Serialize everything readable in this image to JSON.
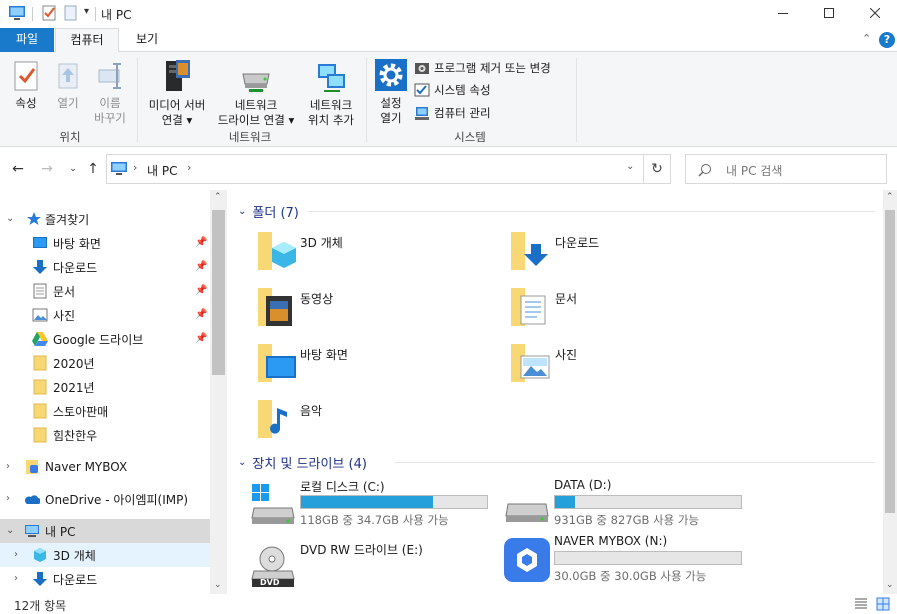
{
  "window": {
    "title": "내 PC"
  },
  "ribbon_tabs": {
    "file": "파일",
    "computer": "컴퓨터",
    "view": "보기"
  },
  "ribbon": {
    "properties": "속성",
    "open": "열기",
    "rename_l1": "이름",
    "rename_l2": "바꾸기",
    "group_location": "위치",
    "media_server_l1": "미디어 서버",
    "media_server_l2": "연결",
    "map_drive_l1": "네트워크",
    "map_drive_l2": "드라이브 연결",
    "add_location_l1": "네트워크",
    "add_location_l2": "위치 추가",
    "group_network": "네트워크",
    "settings_l1": "설정",
    "settings_l2": "열기",
    "uninstall": "프로그램 제거 또는 변경",
    "system_props": "시스템 속성",
    "manage": "컴퓨터 관리",
    "group_system": "시스템"
  },
  "address": {
    "path": "내 PC",
    "search_placeholder": "내 PC 검색"
  },
  "nav": {
    "quick_access": "즐겨찾기",
    "items": [
      {
        "label": "바탕 화면"
      },
      {
        "label": "다운로드"
      },
      {
        "label": "문서"
      },
      {
        "label": "사진"
      },
      {
        "label": "Google 드라이브"
      },
      {
        "label": "2020년"
      },
      {
        "label": "2021년"
      },
      {
        "label": "스토아판매"
      },
      {
        "label": "힘찬한우"
      }
    ],
    "mybox": "Naver MYBOX",
    "onedrive": "OneDrive - 아이엠피(IMP)",
    "this_pc": "내 PC",
    "pc_items": [
      {
        "label": "3D 개체"
      },
      {
        "label": "다운로드"
      }
    ]
  },
  "content": {
    "folders_header": "폴더 (7)",
    "folders": [
      {
        "label": "3D 개체"
      },
      {
        "label": "다운로드"
      },
      {
        "label": "동영상"
      },
      {
        "label": "문서"
      },
      {
        "label": "바탕 화면"
      },
      {
        "label": "사진"
      },
      {
        "label": "음악"
      }
    ],
    "drives_header": "장치 및 드라이브 (4)",
    "drives": [
      {
        "name": "로컬 디스크 (C:)",
        "space": "118GB 중 34.7GB 사용 가능",
        "used_fraction": 0.71
      },
      {
        "name": "DATA (D:)",
        "space": "931GB 중 827GB 사용 가능",
        "used_fraction": 0.11
      },
      {
        "name": "DVD RW 드라이브 (E:)",
        "space": ""
      },
      {
        "name": "NAVER MYBOX (N:)",
        "space": "30.0GB 중 30.0GB 사용 가능",
        "used_fraction": 0.0
      }
    ],
    "dvd_badge": "DVD"
  },
  "status": {
    "count": "12개 항목"
  },
  "colors": {
    "accent": "#1979ca",
    "bar_fill": "#26a0da",
    "group_header": "#1e3287",
    "folder": "#f8d775"
  }
}
